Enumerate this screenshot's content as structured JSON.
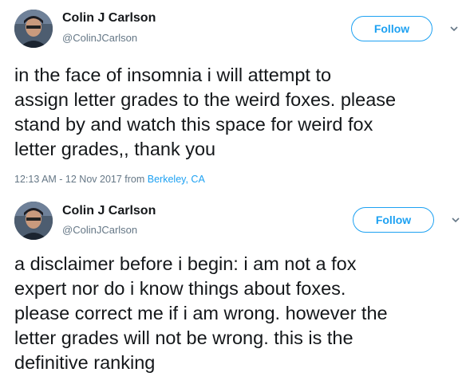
{
  "tweets": [
    {
      "name": "Colin J Carlson",
      "handle": "@ColinJCarlson",
      "follow_label": "Follow",
      "text": "in the face of insomnia i will attempt to\nassign letter grades to the weird foxes. please\nstand by and watch this space for weird fox\nletter grades,, thank you",
      "timestamp": "12:13 AM - 12 Nov 2017 from ",
      "location": "Berkeley, CA"
    },
    {
      "name": "Colin J Carlson",
      "handle": "@ColinJCarlson",
      "follow_label": "Follow",
      "text": "a disclaimer before i begin: i am not a fox\nexpert nor do i know things about foxes.\nplease correct me if i am wrong. however the\nletter grades will not be wrong. this is the\ndefinitive ranking"
    }
  ],
  "icons": {
    "more": "chevron-down-icon"
  },
  "colors": {
    "accent": "#1da1f2",
    "secondary_text": "#657786",
    "primary_text": "#14171a"
  }
}
